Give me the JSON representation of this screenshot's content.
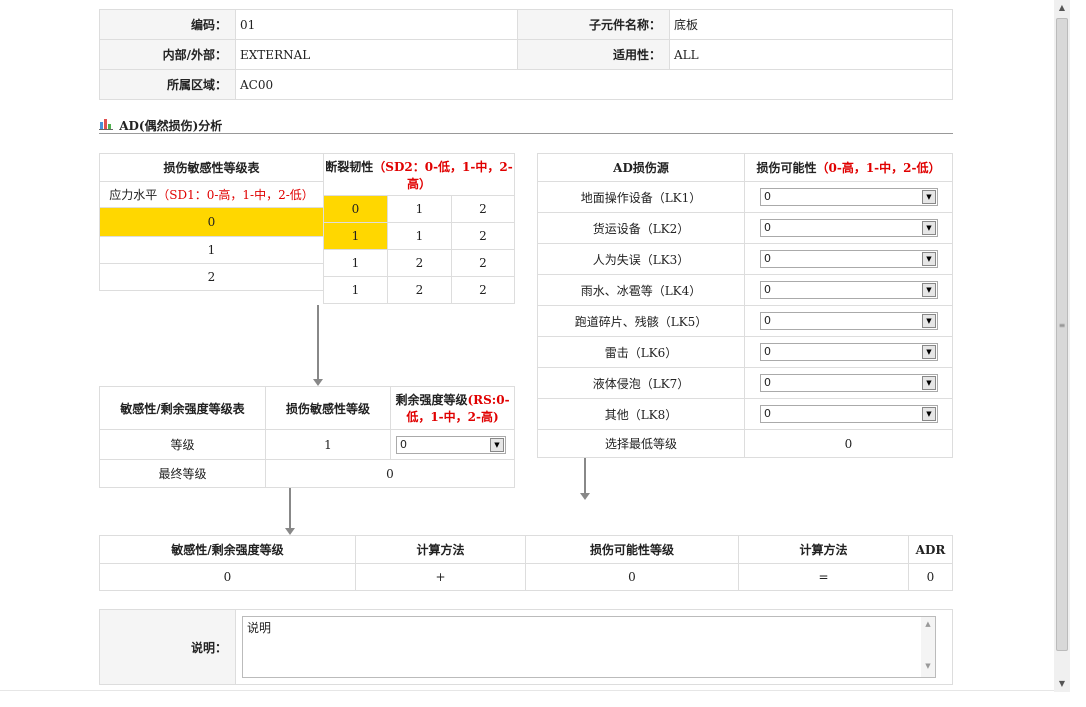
{
  "info": {
    "code_label": "编码：",
    "code_value": "01",
    "sub_label": "子元件名称：",
    "sub_value": "底板",
    "inout_label": "内部/外部：",
    "inout_value": "EXTERNAL",
    "applic_label": "适用性：",
    "applic_value": "ALL",
    "zone_label": "所属区域：",
    "zone_value": "AC00"
  },
  "section": {
    "title": "AD(偶然损伤)分析",
    "icon": "chart-icon"
  },
  "sens": {
    "header": "损伤敏感性等级表",
    "stress_label": "应力水平",
    "stress_note": "（SD1：0-高，1-中，2-低）",
    "rows": [
      "0",
      "1",
      "2"
    ]
  },
  "frac": {
    "header": "断裂韧性",
    "header_note": "（SD2：0-低，1-中，2-高）",
    "rows": [
      [
        "0",
        "1",
        "2"
      ],
      [
        "1",
        "1",
        "2"
      ],
      [
        "1",
        "2",
        "2"
      ],
      [
        "1",
        "2",
        "2"
      ]
    ]
  },
  "resid": {
    "h1": "敏感性/剩余强度等级表",
    "h2": "损伤敏感性等级",
    "h3": "剩余强度等级",
    "h3_note": "(RS:0-低，1-中，2-高)",
    "level_label": "等级",
    "level_value": "1",
    "select_value": "0",
    "final_label": "最终等级",
    "final_value": "0"
  },
  "ad": {
    "h1": "AD损伤源",
    "h2": "损伤可能性",
    "h2_note": "（0-高，1-中，2-低）",
    "sources": [
      {
        "label": "地面操作设备（LK1）",
        "value": "0"
      },
      {
        "label": "货运设备（LK2）",
        "value": "0"
      },
      {
        "label": "人为失误（LK3）",
        "value": "0"
      },
      {
        "label": "雨水、冰雹等（LK4）",
        "value": "0"
      },
      {
        "label": "跑道碎片、残骸（LK5）",
        "value": "0"
      },
      {
        "label": "雷击（LK6）",
        "value": "0"
      },
      {
        "label": "液体侵泡（LK7）",
        "value": "0"
      },
      {
        "label": "其他（LK8）",
        "value": "0"
      }
    ],
    "min_label": "选择最低等级",
    "min_value": "0"
  },
  "result": {
    "headers": [
      "敏感性/剩余强度等级",
      "计算方法",
      "损伤可能性等级",
      "计算方法",
      "ADR"
    ],
    "values": [
      "0",
      "+",
      "0",
      "=",
      "0"
    ]
  },
  "notes": {
    "label": "说明：",
    "text": "说明"
  },
  "colors": {
    "highlight": "#ffd700",
    "note_red": "#e00000"
  }
}
